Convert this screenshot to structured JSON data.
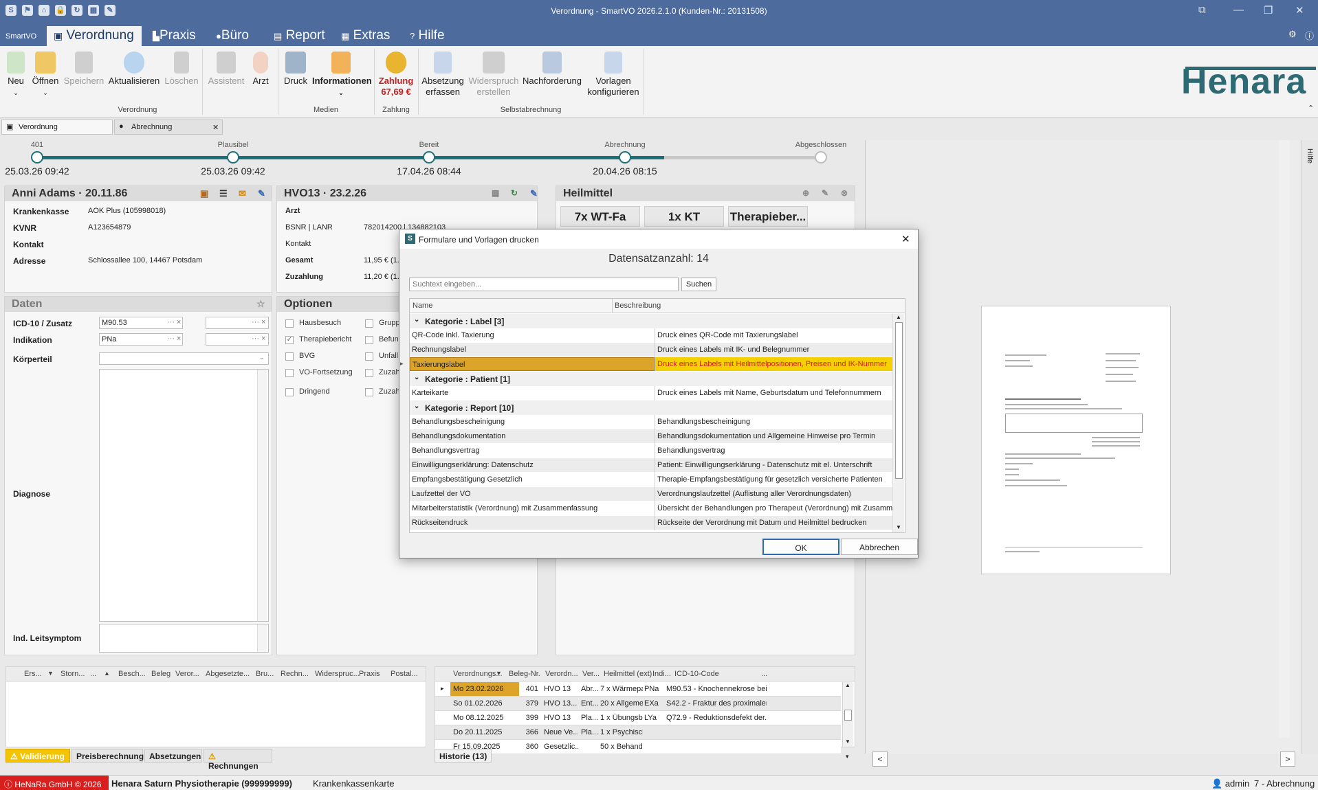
{
  "window": {
    "title": "Verordnung - SmartVO 2026.2.1.0 (Kunden-Nr.: 20131508)"
  },
  "menu": {
    "app": "SmartVO",
    "tabs": [
      "Verordnung",
      "Praxis",
      "Büro",
      "Report",
      "Extras",
      "Hilfe"
    ]
  },
  "ribbon": {
    "buttons": {
      "neu": "Neu",
      "oeffnen": "Öffnen",
      "speichern": "Speichern",
      "aktualisieren": "Aktualisieren",
      "loeschen": "Löschen",
      "assistent": "Assistent",
      "arzt": "Arzt",
      "druck": "Druck",
      "informationen": "Informationen",
      "zahlung": "Zahlung",
      "zahlung_amount": "67,69 €",
      "absetzung": "Absetzung erfassen",
      "widerspruch": "Widerspruch erstellen",
      "nachforderung": "Nachforderung",
      "vorlagen": "Vorlagen konfigurieren"
    },
    "groups": {
      "verordnung": "Verordnung",
      "medien": "Medien",
      "zahlung": "Zahlung",
      "selbstabrechnung": "Selbstabrechnung"
    },
    "logo": "Henara"
  },
  "doc_tabs": {
    "tab1": "Verordnung",
    "tab2": "Abrechnung"
  },
  "progress": {
    "steps": [
      {
        "label": "401",
        "date": "25.03.26 09:42"
      },
      {
        "label": "Plausibel",
        "date": "25.03.26 09:42"
      },
      {
        "label": "Bereit",
        "date": "17.04.26 08:44"
      },
      {
        "label": "Abrechnung",
        "date": "20.04.26 08:15"
      },
      {
        "label": "Abgeschlossen",
        "date": ""
      }
    ],
    "fraction": 0.8
  },
  "patient": {
    "header": "Anni Adams · 20.11.86",
    "kk_label": "Krankenkasse",
    "kk": "AOK Plus (105998018)",
    "kvnr_label": "KVNR",
    "kvnr": "A123654879",
    "kontakt_label": "Kontakt",
    "kontakt": "",
    "adresse_label": "Adresse",
    "adresse": "Schlossallee 100,  14467 Potsdam"
  },
  "vo": {
    "header": "HVO13 · 23.2.26",
    "arzt_label": "Arzt",
    "bsnr_label": "BSNR | LANR",
    "bsnr": "782014200 | 134882103",
    "kontakt_label": "Kontakt",
    "gesamt_label": "Gesamt",
    "gesamt": "11,95 € (1...",
    "zuzahlung_label": "Zuzahlung",
    "zuzahlung": "11,20 € (1..."
  },
  "heilmittel": {
    "header": "Heilmittel",
    "items": [
      "7x WT-Fa",
      "1x KT",
      "Therapieber..."
    ]
  },
  "daten": {
    "header": "Daten",
    "icd_label": "ICD-10 / Zusatz",
    "icd": "M90.53",
    "ind_label": "Indikation",
    "ind": "PNa",
    "koerper_label": "Körperteil",
    "diagnose_label": "Diagnose",
    "leitsymptom_label": "Ind. Leitsymptom"
  },
  "optionen": {
    "header": "Optionen",
    "left": [
      {
        "label": "Hausbesuch",
        "checked": false
      },
      {
        "label": "Therapiebericht",
        "checked": true
      },
      {
        "label": "BVG",
        "checked": false
      },
      {
        "label": "VO-Fortsetzung",
        "checked": false
      },
      {
        "label": "Dringend",
        "checked": false
      }
    ],
    "right": [
      "Gruppe",
      "Befund",
      "Unfall",
      "Zuzahl",
      "Zuzahl"
    ]
  },
  "left_grid": {
    "columns": [
      "Ers...",
      "Storn...",
      "...",
      "Besch...",
      "Beleg",
      "Veror...",
      "Abgesetzte...",
      "Bru...",
      "Rechn...",
      "Widerspruc...",
      "Praxis",
      "Postal..."
    ]
  },
  "bottom_tabs_left": [
    "Validierung",
    "Preisberechnung",
    "Absetzungen",
    "Rechnungen"
  ],
  "historie": {
    "columns": [
      "Verordnungs...",
      "Beleg-Nr.",
      "Verordn...",
      "Ver...",
      "Heilmittel (ext)",
      "Indi...",
      "ICD-10-Code",
      "..."
    ],
    "rows": [
      [
        "Mo 23.02.2026",
        "401",
        "HVO 13",
        "Abr...",
        "7 x Wärmepac...",
        "PNa",
        "M90.53 - Knochennekrose bei s..."
      ],
      [
        "So 01.02.2026",
        "379",
        "HVO 13...",
        "Ent...",
        "20 x Allgemein...",
        "EXa",
        "S42.2 - Fraktur des proximalen..."
      ],
      [
        "Mo 08.12.2025",
        "399",
        "HVO 13",
        "Pla...",
        "1 x Übungsbe...",
        "LYa",
        "Q72.9 - Reduktionsdefekt der..."
      ],
      [
        "Do 20.11.2025",
        "366",
        "Neue Ve...",
        "Pla...",
        "1 x Psychisch-...",
        "",
        ""
      ],
      [
        "Fr 15.09.2025",
        "360",
        "Gesetzlic...",
        "",
        "50 x Behand...",
        "",
        ""
      ]
    ],
    "tab": "Historie (13)"
  },
  "dialog": {
    "title": "Formulare und Vorlagen drucken",
    "count": "Datensatzanzahl: 14",
    "search_placeholder": "Suchtext eingeben...",
    "search_btn": "Suchen",
    "col_name": "Name",
    "col_desc": "Beschreibung",
    "groups": [
      {
        "title": "Kategorie : Label [3]",
        "rows": [
          {
            "name": "QR-Code inkl. Taxierung",
            "desc": "Druck eines QR-Code mit Taxierungslabel",
            "selected": false
          },
          {
            "name": "Rechnungslabel",
            "desc": "Druck eines Labels mit IK- und Belegnummer",
            "selected": false
          },
          {
            "name": "Taxierungslabel",
            "desc": "Druck eines Labels mit Heilmittelpositionen, Preisen und IK-Nummer",
            "selected": true
          }
        ]
      },
      {
        "title": "Kategorie : Patient [1]",
        "rows": [
          {
            "name": "Karteikarte",
            "desc": "Druck eines Labels mit Name, Geburtsdatum und Telefonnummern",
            "selected": false
          }
        ]
      },
      {
        "title": "Kategorie : Report [10]",
        "rows": [
          {
            "name": "Behandlungsbescheinigung",
            "desc": "Behandlungsbescheinigung",
            "selected": false
          },
          {
            "name": "Behandlungsdokumentation",
            "desc": "Behandlungsdokumentation und Allgemeine Hinweise pro Termin",
            "selected": false
          },
          {
            "name": "Behandlungsvertrag",
            "desc": "Behandlungsvertrag",
            "selected": false
          },
          {
            "name": "Einwilligungserklärung: Datenschutz",
            "desc": "Patient: Einwilligungserklärung - Datenschutz mit el. Unterschrift",
            "selected": false
          },
          {
            "name": "Empfangsbestätigung Gesetzlich",
            "desc": "Therapie-Empfangsbestätigung für gesetzlich versicherte Patienten",
            "selected": false
          },
          {
            "name": "Laufzettel der VO",
            "desc": "Verordnungslaufzettel (Auflistung aller Verordnungsdaten)",
            "selected": false
          },
          {
            "name": "Mitarbeiterstatistik (Verordnung) mit Zusammenfassung",
            "desc": "Übersicht der Behandlungen pro Therapeut (Verordnung) mit Zusamme...",
            "selected": false
          },
          {
            "name": "Rückseitendruck",
            "desc": "Rückseite der Verordnung mit Datum und Heilmittel bedrucken",
            "selected": false
          }
        ]
      }
    ],
    "ok": "OK",
    "cancel": "Abbrechen"
  },
  "preview": {
    "hilfe": "Hilfe",
    "prev": "<",
    "next": ">"
  },
  "statusbar": {
    "copyright": "HeNaRa GmbH © 2026",
    "practice": "Henara Saturn Physiotherapie (999999999)",
    "card": "Krankenkassenkarte",
    "user": "admin",
    "mode": "7 - Abrechnung"
  },
  "colors": {
    "accent": "#4d6b9c",
    "teal": "#1c6e77",
    "selection": "#dca52a",
    "highlight": "#f5d000",
    "error_text": "#d22020",
    "warning": "#f5c400"
  }
}
